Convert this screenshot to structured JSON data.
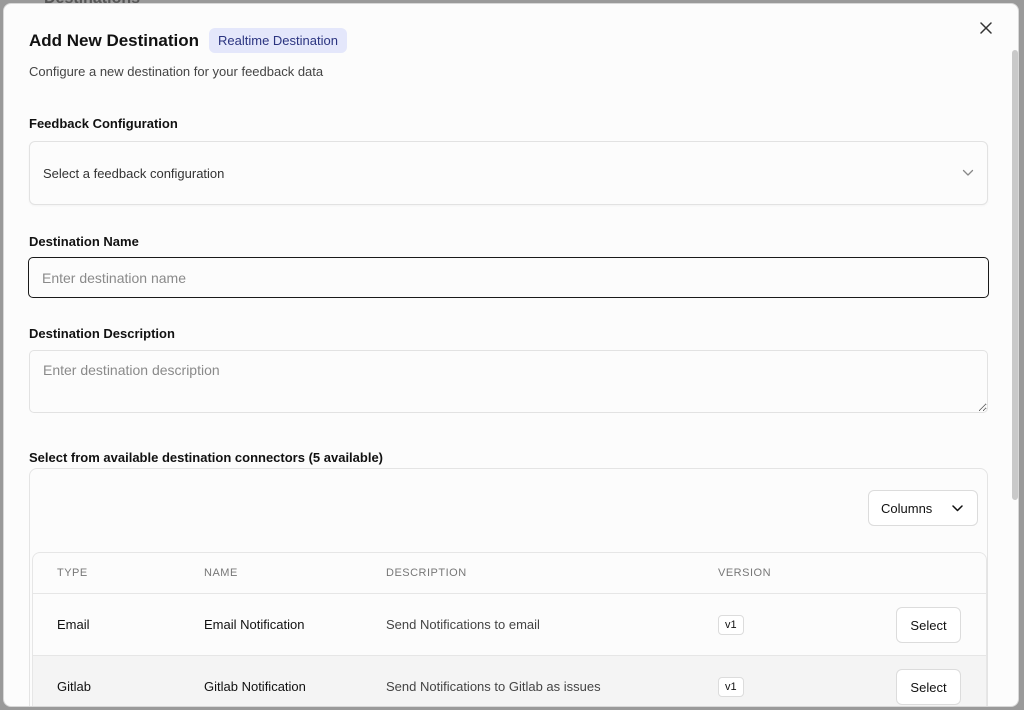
{
  "backdrop": {
    "title": "Destinations"
  },
  "modal": {
    "title": "Add New Destination",
    "badge": "Realtime Destination",
    "subtitle": "Configure a new destination for your feedback data"
  },
  "form": {
    "feedback_config": {
      "label": "Feedback Configuration",
      "placeholder": "Select a feedback configuration"
    },
    "destination_name": {
      "label": "Destination Name",
      "placeholder": "Enter destination name",
      "value": ""
    },
    "destination_description": {
      "label": "Destination Description",
      "placeholder": "Enter destination description",
      "value": ""
    }
  },
  "connectors": {
    "label": "Select from available destination connectors (5 available)",
    "columns_button": "Columns",
    "headers": [
      "TYPE",
      "NAME",
      "DESCRIPTION",
      "VERSION"
    ],
    "rows": [
      {
        "type": "Email",
        "name": "Email Notification",
        "description": "Send Notifications to email",
        "version": "v1",
        "action": "Select"
      },
      {
        "type": "Gitlab",
        "name": "Gitlab Notification",
        "description": "Send Notifications to Gitlab as issues",
        "version": "v1",
        "action": "Select"
      }
    ]
  },
  "icons": {
    "close": "close-icon",
    "select_chevron": "chevron-down-icon",
    "columns_chevron": "chevron-down-icon"
  },
  "colors": {
    "badge_bg": "#e4e7fb",
    "badge_text": "#2b3480",
    "focus_border": "#1a1a1a"
  }
}
